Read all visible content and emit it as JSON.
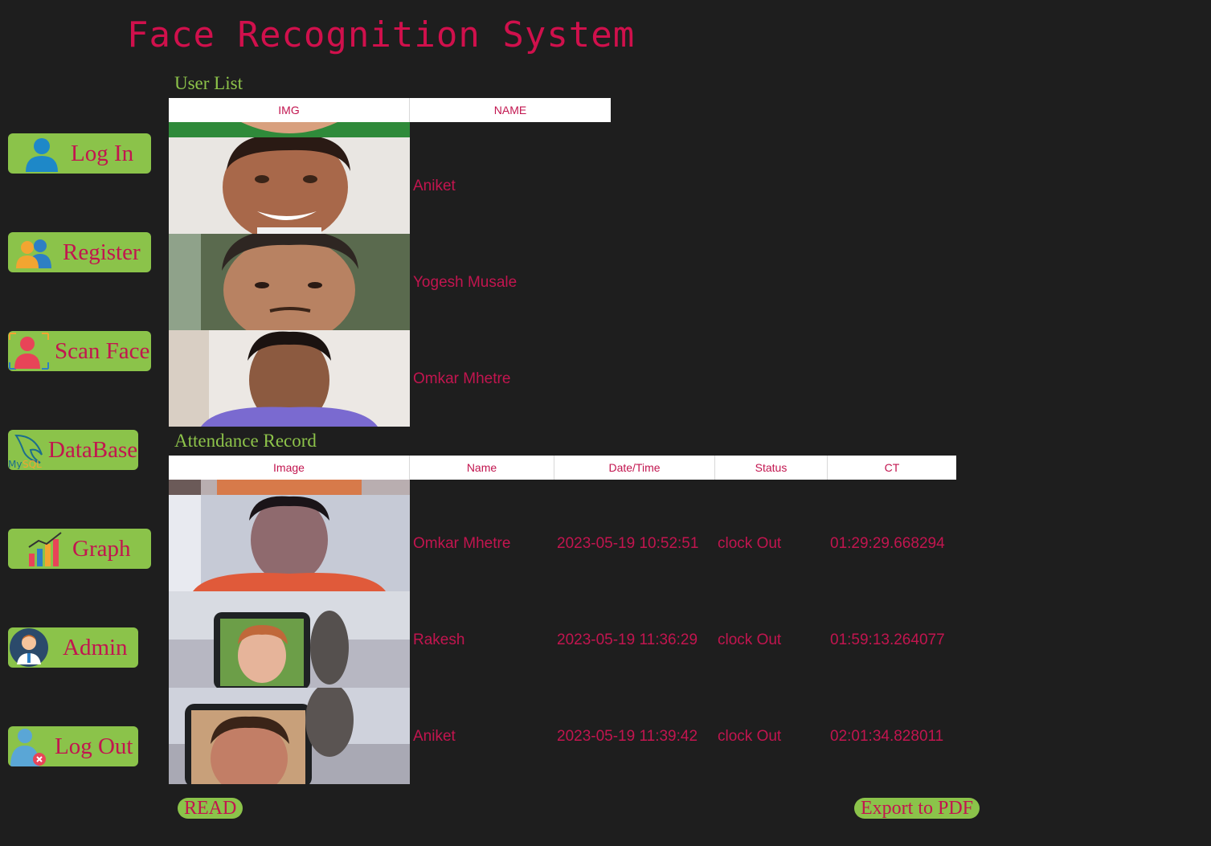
{
  "app": {
    "title": "Face Recognition System"
  },
  "nav": {
    "login": "Log In",
    "register": "Register",
    "scan_face": "Scan Face",
    "database": "DataBase",
    "graph": "Graph",
    "admin": "Admin",
    "logout": "Log Out"
  },
  "user_list": {
    "title": "User List",
    "columns": [
      "IMG",
      "NAME"
    ],
    "rows": [
      {
        "name": "Aniket"
      },
      {
        "name": "Yogesh Musale"
      },
      {
        "name": "Omkar Mhetre"
      }
    ]
  },
  "attendance": {
    "title": "Attendance Record",
    "columns": [
      "Image",
      "Name",
      "Date/Time",
      "Status",
      "CT"
    ],
    "rows": [
      {
        "name": "Omkar Mhetre",
        "datetime": "2023-05-19 10:52:51",
        "status": "clock Out",
        "ct": "01:29:29.668294"
      },
      {
        "name": "Rakesh",
        "datetime": "2023-05-19 11:36:29",
        "status": "clock Out",
        "ct": "01:59:13.264077"
      },
      {
        "name": "Aniket",
        "datetime": "2023-05-19 11:39:42",
        "status": "clock Out",
        "ct": "02:01:34.828011"
      }
    ]
  },
  "actions": {
    "read": "READ",
    "export_pdf": "Export to PDF"
  },
  "colors": {
    "background": "#1e1e1e",
    "accent_green": "#8bc34a",
    "text_crimson": "#c2154f",
    "title_red": "#d0104c"
  },
  "icons": [
    "user-icon",
    "group-icon",
    "scan-face-icon",
    "mysql-dolphin-icon",
    "bar-chart-icon",
    "admin-avatar-icon",
    "logout-user-icon"
  ]
}
